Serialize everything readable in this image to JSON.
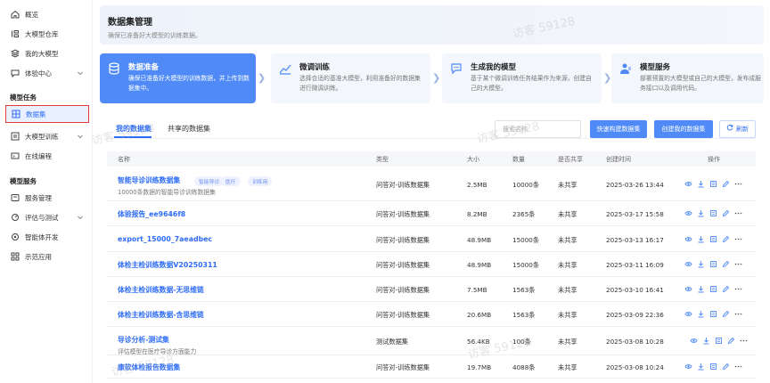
{
  "sidebar": {
    "items": [
      {
        "label": "概览",
        "icon": "home-icon"
      },
      {
        "label": "大模型仓库",
        "icon": "grid-icon"
      },
      {
        "label": "我的大模型",
        "icon": "layers-icon"
      },
      {
        "label": "体验中心",
        "icon": "chat-icon"
      }
    ],
    "group1": "模型任务",
    "group1_items": [
      {
        "label": "数据集",
        "icon": "table-icon"
      },
      {
        "label": "大模型训练",
        "icon": "train-icon"
      },
      {
        "label": "在线编程",
        "icon": "code-icon"
      }
    ],
    "group2": "模型服务",
    "group2_items": [
      {
        "label": "服务管理",
        "icon": "service-icon"
      },
      {
        "label": "评估与测试",
        "icon": "eval-icon"
      },
      {
        "label": "智能体开发",
        "icon": "agent-icon"
      },
      {
        "label": "示范应用",
        "icon": "apps-icon"
      }
    ]
  },
  "header": {
    "title": "数据集管理",
    "subtitle": "确保已准备好大模型的训练数据。"
  },
  "steps": [
    {
      "title": "数据准备",
      "desc": "确保已准备好大模型的训练数据，并上传到数据集中。"
    },
    {
      "title": "微调训练",
      "desc": "选择合适的基准大模型，利用准备好的数据集进行微调训练。"
    },
    {
      "title": "生成我的模型",
      "desc": "基于某个微调训练任务结果作为来源，创建自己的大模型。"
    },
    {
      "title": "模型服务",
      "desc": "部署预置的大模型或自己的大模型，发布成服务接口以及调用代码。"
    }
  ],
  "tabs": [
    "我的数据集",
    "共享的数据集"
  ],
  "toolbar": {
    "search_placeholder": "搜索名称",
    "quick_build": "快速构建数据集",
    "create": "创建我的数据集",
    "refresh": "刷新"
  },
  "table": {
    "columns": [
      "名称",
      "类型",
      "大小",
      "数量",
      "是否共享",
      "创建时间",
      "操作"
    ],
    "rows": [
      {
        "name": "智能导诊训练数据集",
        "tags": [
          "智能导诊",
          "医疗",
          "训练用"
        ],
        "desc": "10000条数据的智能导诊训练数据集",
        "type": "问答对-训练数据集",
        "size": "2.5MB",
        "count": "10000条",
        "shared": "未共享",
        "time": "2025-03-26 13:44"
      },
      {
        "name": "体验报告_ee9646f8",
        "tags": [],
        "desc": "",
        "type": "问答对-训练数据集",
        "size": "8.2MB",
        "count": "2365条",
        "shared": "未共享",
        "time": "2025-03-17 15:58"
      },
      {
        "name": "export_15000_7aeadbec",
        "tags": [],
        "desc": "",
        "type": "问答对-训练数据集",
        "size": "48.9MB",
        "count": "15000条",
        "shared": "未共享",
        "time": "2025-03-13 16:17"
      },
      {
        "name": "体检主检训练数据V20250311",
        "tags": [],
        "desc": "",
        "type": "问答对-训练数据集",
        "size": "48.9MB",
        "count": "15000条",
        "shared": "未共享",
        "time": "2025-03-11 16:09"
      },
      {
        "name": "体检主检训练数据-无思维链",
        "tags": [],
        "desc": "",
        "type": "问答对-训练数据集",
        "size": "7.5MB",
        "count": "1563条",
        "shared": "未共享",
        "time": "2025-03-10 16:41"
      },
      {
        "name": "体检主检训练数据-含思维链",
        "tags": [],
        "desc": "",
        "type": "问答对-训练数据集",
        "size": "20.6MB",
        "count": "1563条",
        "shared": "未共享",
        "time": "2025-03-09 22:36"
      },
      {
        "name": "导诊分析-测试集",
        "tags": [],
        "desc": "评估模型在医疗导诊方面能力",
        "type": "测试数据集",
        "size": "56.4KB",
        "count": "100条",
        "shared": "未共享",
        "time": "2025-03-08 10:28"
      },
      {
        "name": "康软体检报告数据集",
        "tags": [],
        "desc": "",
        "type": "问答对-训练数据集",
        "size": "19.7MB",
        "count": "4088条",
        "shared": "未共享",
        "time": "2025-03-08 10:24"
      }
    ]
  },
  "watermark": "访客 59128",
  "colors": {
    "accent": "#2f6df6",
    "step_active": "#4f8af7",
    "highlight_border": "#e23b3b"
  }
}
